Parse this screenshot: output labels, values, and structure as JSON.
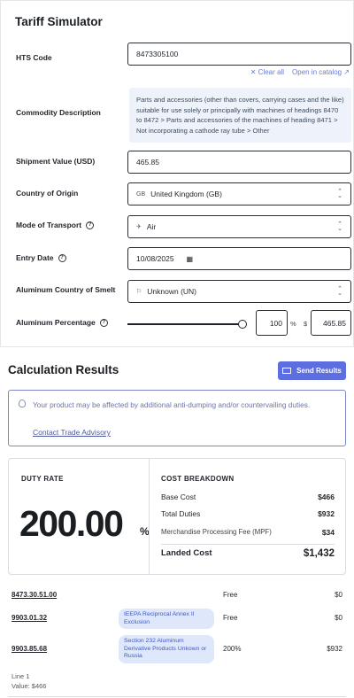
{
  "form": {
    "title": "Tariff Simulator",
    "hts_code": {
      "label": "HTS Code",
      "value": "8473305100"
    },
    "links": {
      "clear_all": "Clear all",
      "open_catalog": "Open in catalog"
    },
    "commodity": {
      "label": "Commodity Description",
      "text": "Parts and accessories (other than covers, carrying cases and the like) suitable for use solely or principally with machines of headings 8470 to 8472 > Parts and accessories of the machines of heading 8471 > Not incorporating a cathode ray tube > Other"
    },
    "shipment_value": {
      "label": "Shipment Value (USD)",
      "value": "465.85"
    },
    "origin": {
      "label": "Country of Origin",
      "prefix": "GB",
      "value": "United Kingdom (GB)"
    },
    "transport": {
      "label": "Mode of Transport",
      "value": "Air"
    },
    "entry_date": {
      "label": "Entry Date",
      "value": "10/08/2025"
    },
    "smelt": {
      "label": "Aluminum Country of Smelt",
      "value": "Unknown (UN)"
    },
    "aluminum_pct": {
      "label": "Aluminum Percentage",
      "value": "100",
      "pct_symbol": "%",
      "dollar_symbol": "$",
      "amount": "465.85",
      "slider_fraction": 1.0
    }
  },
  "results": {
    "title": "Calculation Results",
    "send_label": "Send Results",
    "advisory_text": "Your product may be affected by additional anti-dumping and/or countervailing duties.",
    "advisory_link": "Contact Trade Advisory",
    "duty": {
      "label": "DUTY RATE",
      "value": "200.00",
      "pct": "%"
    },
    "cost": {
      "heading": "COST BREAKDOWN",
      "base_label": "Base Cost",
      "base_value": "$466",
      "duties_label": "Total Duties",
      "duties_value": "$932",
      "mpf_label": "Merchandise Processing Fee (MPF)",
      "mpf_value": "$34",
      "landed_label": "Landed Cost",
      "landed_value": "$1,432"
    },
    "lines": [
      {
        "code": "8473.30.51.00",
        "tag": "",
        "rate": "Free",
        "amount": "$0"
      },
      {
        "code": "9903.01.32",
        "tag": "IEEPA Reciprocal Annex II Exclusion",
        "rate": "Free",
        "amount": "$0"
      },
      {
        "code": "9903.85.68",
        "tag": "Section 232 Aluminum Derivative Products Unkown or Russia",
        "rate": "200%",
        "amount": "$932"
      }
    ],
    "line_caption": {
      "line": "Line 1",
      "value": "Value: $466"
    }
  },
  "colors": {
    "accent": "#5d6fe0",
    "tag_bg": "#dfe8fb",
    "desc_bg": "#eef3fb"
  }
}
